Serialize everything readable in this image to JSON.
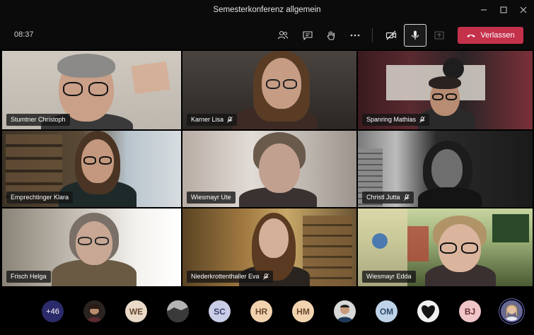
{
  "window": {
    "title": "Semesterkonferenz allgemein",
    "controls": [
      "minimize",
      "maximize",
      "close"
    ]
  },
  "toolbar": {
    "timer": "08:37",
    "buttons": [
      "participants-icon",
      "chat-icon",
      "raise-hand-icon",
      "more-icon",
      "camera-off-icon",
      "mic-icon",
      "share-icon"
    ],
    "leave_label": "Verlassen",
    "leave_color": "#c4314b"
  },
  "participants": [
    {
      "name": "Stumtner Christoph",
      "muted": false
    },
    {
      "name": "Karner Lisa",
      "muted": true
    },
    {
      "name": "Spanring Mathias",
      "muted": true
    },
    {
      "name": "Emprechtinger Klara",
      "muted": false
    },
    {
      "name": "Wiesmayr Ute",
      "muted": false
    },
    {
      "name": "Christl Jutta",
      "muted": true
    },
    {
      "name": "Frisch Helga",
      "muted": false
    },
    {
      "name": "Niederkrottenthaller Eva",
      "muted": true
    },
    {
      "name": "Wiesmayr Edda",
      "muted": false
    }
  ],
  "avatar_strip": {
    "overflow": "+46",
    "avatars": [
      {
        "type": "photo",
        "label": ""
      },
      {
        "type": "initials",
        "label": "WE",
        "bg": "#e9d9c9",
        "fg": "#6b4a2f"
      },
      {
        "type": "photo",
        "label": ""
      },
      {
        "type": "initials",
        "label": "SC",
        "bg": "#c9cde6",
        "fg": "#3b3f6e"
      },
      {
        "type": "initials",
        "label": "HR",
        "bg": "#f2d3b0",
        "fg": "#6b4a2f"
      },
      {
        "type": "initials",
        "label": "HM",
        "bg": "#f2d3b0",
        "fg": "#6b4a2f"
      },
      {
        "type": "photo",
        "label": ""
      },
      {
        "type": "initials",
        "label": "OM",
        "bg": "#bfd3e8",
        "fg": "#2f4a6b"
      },
      {
        "type": "photo",
        "label": ""
      },
      {
        "type": "initials",
        "label": "BJ",
        "bg": "#f0c5c8",
        "fg": "#6b2f36"
      },
      {
        "type": "photo",
        "label": "",
        "self": true
      }
    ],
    "accent": "#6264a7"
  }
}
